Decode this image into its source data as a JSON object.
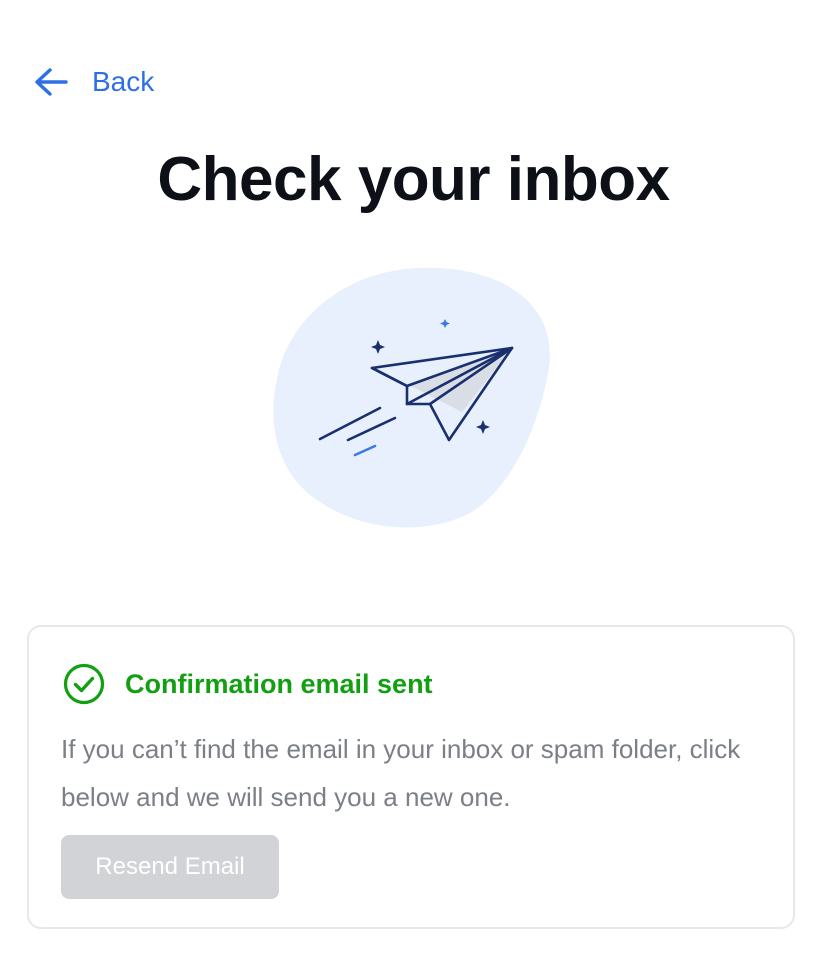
{
  "nav": {
    "back_label": "Back",
    "back_icon": "arrow-left-icon"
  },
  "page": {
    "title": "Check your inbox"
  },
  "illustration": {
    "icon": "paper-plane-icon"
  },
  "status_card": {
    "icon": "check-circle-icon",
    "status": "Confirmation email sent",
    "description": "If you can’t find the email in your inbox or spam folder, click below and we will send you a new one.",
    "resend_label": "Resend Email",
    "resend_disabled": true
  },
  "colors": {
    "accent": "#2f6fe4",
    "title": "#0d1117",
    "success": "#12a012",
    "muted_text": "#7b7f86",
    "blob": "#e8f0fd",
    "plane_stroke": "#1a2f6e",
    "card_border": "#e6e8eb",
    "disabled_button": "#d1d3d6"
  }
}
